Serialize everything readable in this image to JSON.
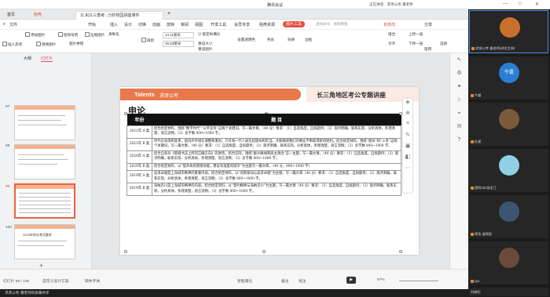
{
  "meeting": {
    "title": "腾讯会议",
    "recording": "正在讲话：求贤公考-潘老师"
  },
  "wps": {
    "tabs": [
      {
        "label": "首页"
      },
      {
        "label": "稻壳"
      },
      {
        "label": "11.8(11三角考...分析校园讲座课件"
      }
    ],
    "menus": [
      "文件",
      "开始",
      "插入",
      "设计",
      "切换",
      "动画",
      "放映",
      "审阅",
      "视图",
      "开发工具",
      "会员专享",
      "稻壳资源",
      "图片工具"
    ],
    "active_menu": "图片工具",
    "search_placeholder": "查找命令、搜索模板",
    "right_actions": [
      "有修改",
      "分享"
    ],
    "ribbon": {
      "row1": [
        "添加图片",
        "抠除背景",
        "压缩图片",
        "清晰化",
        "裁剪",
        "14.11厘米",
        "锁定纵横比",
        "重设大小",
        "设置透明色",
        "色彩",
        "效果",
        "边框",
        "组合",
        "上移一层",
        "对齐"
      ],
      "row2": [
        "插入形状",
        "替换图片",
        "图片拼接",
        "29.53厘米",
        "重设图片",
        "下移一层",
        "旋转",
        "选择"
      ]
    }
  },
  "left_panel": {
    "tabs": [
      "大纲",
      "幻灯片"
    ],
    "active_tab": "幻灯片",
    "thumbnails": [
      {
        "num": "97"
      },
      {
        "num": "98"
      },
      {
        "num": "99",
        "selected": true
      },
      {
        "num": "100",
        "caption": "2023年申论考试要求"
      }
    ]
  },
  "slide": {
    "logo": "Talents",
    "logo_sub": "求贤公考",
    "banner_title": "长三角地区考公专题讲座",
    "heading": "申论",
    "table_headers": [
      "年份",
      "题 目"
    ],
    "rows": [
      {
        "year": "2021年 A 类",
        "text": "结合给定材料，围绕“数字时代”“公平竞争”这两个关键词，写一篇文章。（40 分）要求：（1）自选角度，自拟题目；（2）观点明确，联系实际，分析具体，条理清楚，语言流畅；（3）总字数 800~1000 字。"
      },
      {
        "year": "2021年 B 类",
        "text": "时代在动荡和变革，国内外环境在调整和重组，只有每一代人肩负起使命和担当，才能确保我们的事业不断取得新的胜利。结合给定材料，围绕“使命”和“斗争”这两个关键词，写一篇文章。（40 分）要求：（1）自选角度，自拟题目；（2）观点明确，联系实际，分析具体，条理清楚，语言流畅；（3）总字数 800~1000 字。"
      },
      {
        "year": "2020年 A 类",
        "text": "结合自身对《管窥书法上所的正确方向》的讲话，结合实际，围绕“群众路线和民主政治”这一主题，写一篇文章。（40 分）要求：（1）自选角度，自拟题目；（2）观点明确，联系实际，分析具体，条理清楚，语言流畅；（3）总字数 800~1000 字。"
      },
      {
        "year": "2020年 B 类",
        "text": "结合给定材料，以“提升政府管理效能，建设有温度的城市”为主题写一篇文章。（40 分，800~1000 字）"
      },
      {
        "year": "2019年 A 类",
        "text": "追求卓越是上海城市精神的重要内容。结合给定材料，以“创新驱动与追求卓越”为主题，写一篇文章（40 分）要求：（1）自选角度，自拟题目；（2）观点明确，联系实际，分析具体，条理清楚，语言流畅；（3）总字数 800~1000 字。"
      },
      {
        "year": "2019年 B 类",
        "text": "海纳百川是上海城市精神的内容。结合给定资料，以“契约精神与海纳百川”为主题，写一篇文章（40 分）要求：（1）自选角度，自拟题目；（2）观点明确，联系实际，分析具体，条理清楚，语言流畅；（3）总字数 800~1000 字。"
      }
    ]
  },
  "status": {
    "slide_count": "幻灯片 99 / 108",
    "theme": "自定义设计方案",
    "font_missing": "缺失字体",
    "smart_beautify": "智能美化",
    "notes": "备注",
    "comments": "批注",
    "zoom": "67%"
  },
  "bottom": {
    "sharer": "求贤公考-潘老师的屏幕共享"
  },
  "participants": [
    {
      "name": "求贤公考-潘老师(讲话主持)",
      "avatar_color": "#c9702f",
      "active": true
    },
    {
      "name": "牛磊",
      "avatar_text": "牛磊",
      "avatar_color": "#2a7fd4"
    },
    {
      "name": "红星",
      "avatar_color": "#7a5a3a"
    },
    {
      "name": "刘献杞",
      "avatar_color": "#4f4a3a"
    },
    {
      "name": "国科191张定汀",
      "avatar_color": "#8fd0e4"
    },
    {
      "name": "周孜 逢周泉",
      "avatar_color": "#3c5570"
    },
    {
      "name": "yyx",
      "avatar_color": "#6b4a3a"
    }
  ]
}
